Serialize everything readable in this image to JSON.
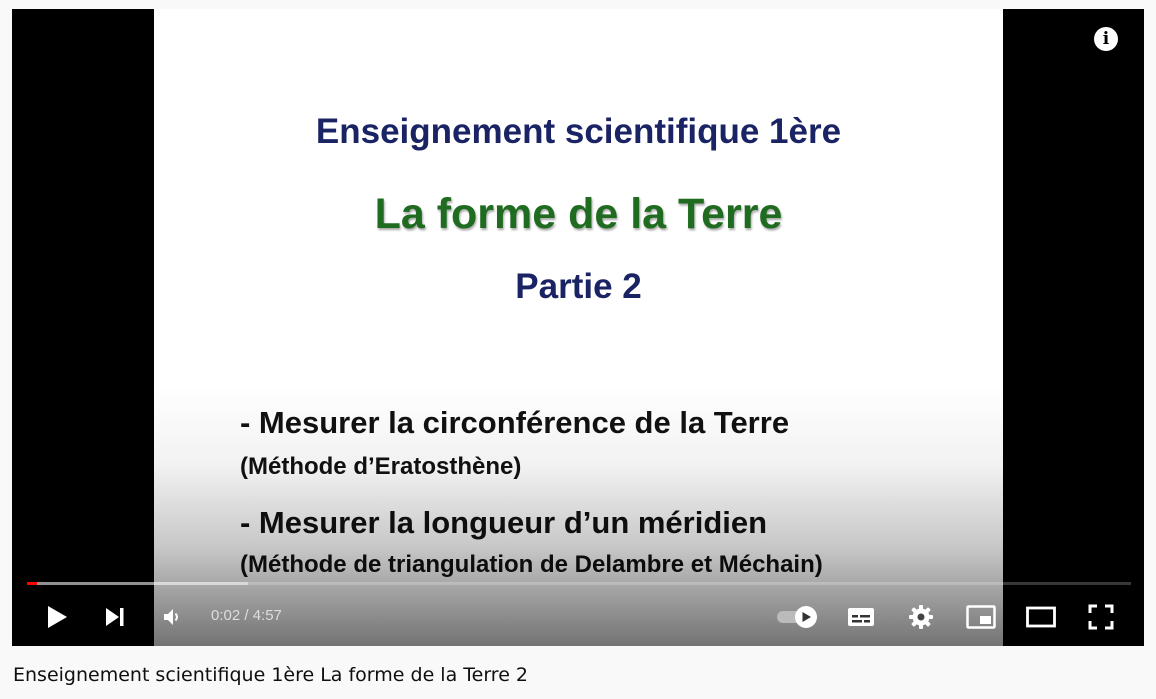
{
  "slide": {
    "title": "Enseignement scientifique 1ère",
    "subtitle": "La forme de la Terre",
    "part": "Partie 2",
    "bullet1": "- Mesurer la circonférence de la Terre",
    "bullet1_sub": "(Méthode d’Eratosthène)",
    "bullet2": "- Mesurer la longueur d’un méridien",
    "bullet2_sub": "(Méthode de triangulation de Delambre et Méchain)"
  },
  "player": {
    "info_icon": "info-icon",
    "current_time": "0:02",
    "duration": "4:57",
    "time_display": "0:02 / 4:57",
    "played_fraction": 0.0067,
    "loaded_fraction": 0.2,
    "played_color": "#ff0000"
  },
  "video": {
    "title": "Enseignement scientifique 1ère La forme de la Terre 2"
  }
}
